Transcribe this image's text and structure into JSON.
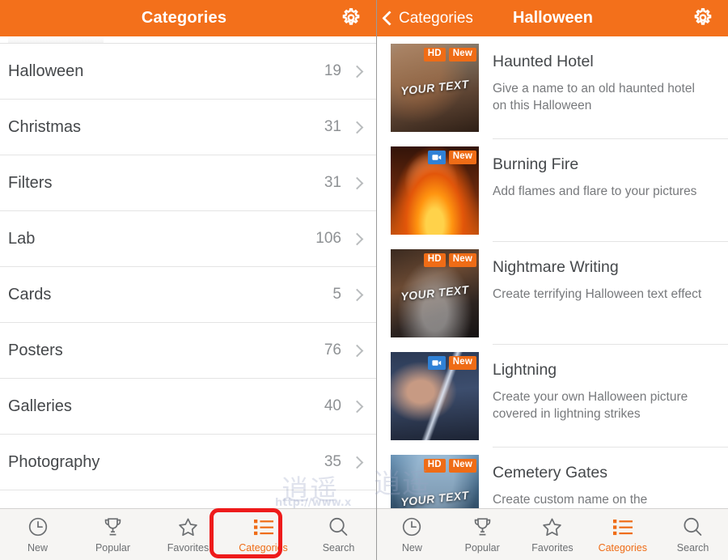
{
  "colors": {
    "brand_orange": "#f3701b",
    "badge_orange": "#ef6c16",
    "badge_blue": "#2f81d6",
    "annotation_red": "#ee1b1b",
    "tabbar_bg": "#f6f5f3",
    "text_primary": "#45484b",
    "text_secondary": "#77797c"
  },
  "left_panel": {
    "navbar": {
      "title": "Categories",
      "gear_icon": "gear-icon"
    },
    "categories": [
      {
        "label": "Halloween",
        "count": "19",
        "chevron": "chevron-right-icon"
      },
      {
        "label": "Christmas",
        "count": "31",
        "chevron": "chevron-right-icon"
      },
      {
        "label": "Filters",
        "count": "31",
        "chevron": "chevron-right-icon"
      },
      {
        "label": "Lab",
        "count": "106",
        "chevron": "chevron-right-icon"
      },
      {
        "label": "Cards",
        "count": "5",
        "chevron": "chevron-right-icon"
      },
      {
        "label": "Posters",
        "count": "76",
        "chevron": "chevron-right-icon"
      },
      {
        "label": "Galleries",
        "count": "40",
        "chevron": "chevron-right-icon"
      },
      {
        "label": "Photography",
        "count": "35",
        "chevron": "chevron-right-icon"
      }
    ]
  },
  "right_panel": {
    "navbar": {
      "back_label": "Categories",
      "back_icon": "chevron-left-icon",
      "title": "Halloween",
      "gear_icon": "gear-icon"
    },
    "effects": [
      {
        "title": "Haunted Hotel",
        "description": "Give a name to an old haunted hotel on this Halloween",
        "badges": [
          "HD",
          "New"
        ],
        "thumb_overlay_text": "YOUR TEXT",
        "thumb_name": "haunted-hotel-thumbnail"
      },
      {
        "title": "Burning Fire",
        "description": "Add flames and flare to your pictures",
        "badges": [
          "video",
          "New"
        ],
        "thumb_overlay_text": "",
        "thumb_name": "burning-fire-thumbnail"
      },
      {
        "title": "Nightmare Writing",
        "description": "Create terrifying Halloween text effect",
        "badges": [
          "HD",
          "New"
        ],
        "thumb_overlay_text": "YOUR TEXT",
        "thumb_name": "nightmare-writing-thumbnail"
      },
      {
        "title": "Lightning",
        "description": "Create your own Halloween picture covered in lightning strikes",
        "badges": [
          "video",
          "New"
        ],
        "thumb_overlay_text": "",
        "thumb_name": "lightning-thumbnail"
      },
      {
        "title": "Cemetery Gates",
        "description": "Create custom name on the",
        "badges": [
          "HD",
          "New"
        ],
        "thumb_overlay_text": "YOUR TEXT",
        "thumb_name": "cemetery-gates-thumbnail"
      }
    ]
  },
  "tabbar": {
    "items": [
      {
        "label": "New",
        "icon": "clock-icon",
        "active": false
      },
      {
        "label": "Popular",
        "icon": "trophy-icon",
        "active": false
      },
      {
        "label": "Favorites",
        "icon": "star-icon",
        "active": false
      },
      {
        "label": "Categories",
        "icon": "list-icon",
        "active": true
      },
      {
        "label": "Search",
        "icon": "search-icon",
        "active": false
      }
    ]
  },
  "watermark": {
    "glyph": "逍遥",
    "url": "http://www.x"
  }
}
